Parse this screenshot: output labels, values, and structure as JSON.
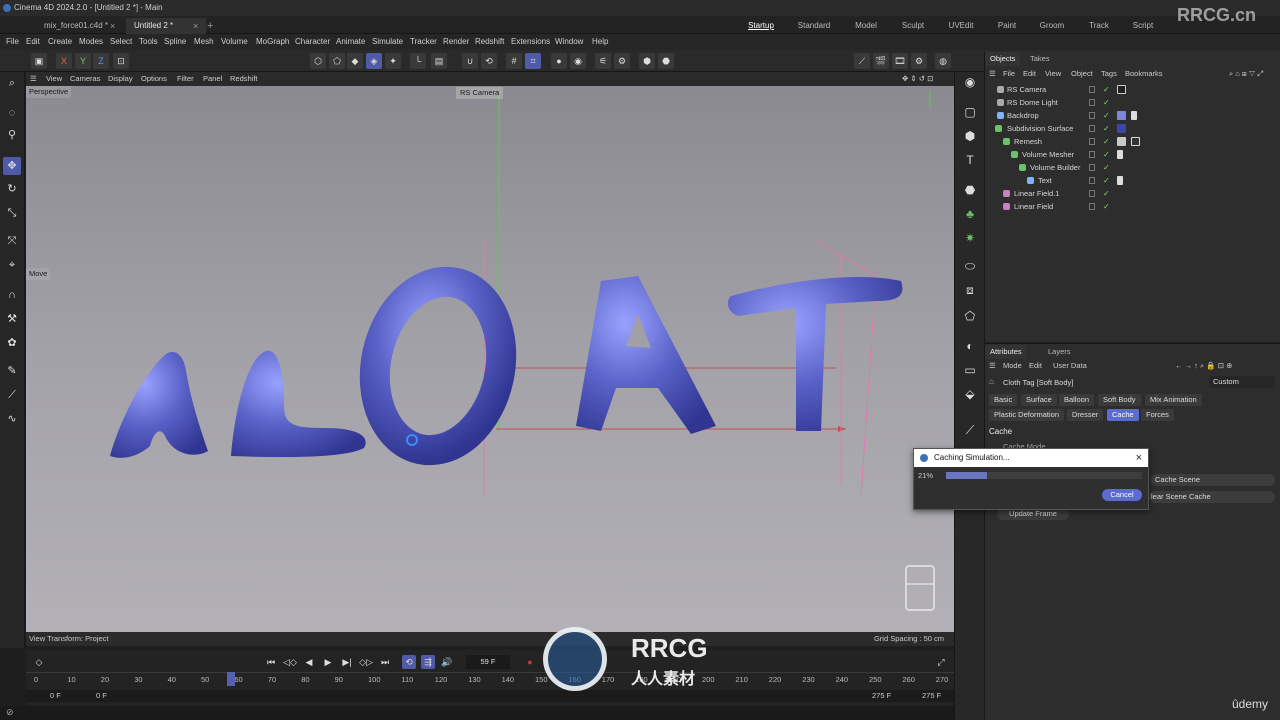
{
  "titlebar": {
    "title": "Cinema 4D 2024.2.0 - [Untitled 2 *] - Main"
  },
  "tabs": {
    "doc1": "mix_force01.c4d *",
    "doc2": "Untitled 2 *",
    "add": "+",
    "close": "×"
  },
  "layouts": [
    "Startup",
    "Standard",
    "Model",
    "Sculpt",
    "UVEdit",
    "Paint",
    "Groom",
    "Track",
    "Script"
  ],
  "menu": [
    "File",
    "Edit",
    "Create",
    "Modes",
    "Select",
    "Tools",
    "Spline",
    "Mesh",
    "Volume",
    "MoGraph",
    "Character",
    "Animate",
    "Simulate",
    "Tracker",
    "Render",
    "Redshift",
    "Extensions",
    "Window",
    "Help"
  ],
  "axes": {
    "x": "X",
    "y": "Y",
    "z": "Z"
  },
  "viewport": {
    "menu": [
      "View",
      "Cameras",
      "Display",
      "Options",
      "Filter",
      "Panel",
      "Redshift"
    ],
    "name": "Perspective",
    "camera": "RS Camera",
    "move_label": "Move",
    "view_transform": "View Transform: Project",
    "grid_spacing": "Grid Spacing : 50 cm",
    "scene_text": "ALOAT"
  },
  "timeline": {
    "current_frame": "59 F",
    "ticks": [
      "0",
      "10",
      "20",
      "30",
      "40",
      "50",
      "60",
      "70",
      "80",
      "90",
      "100",
      "110",
      "120",
      "130",
      "140",
      "150",
      "160",
      "170",
      "180",
      "190",
      "200",
      "210",
      "220",
      "230",
      "240",
      "250",
      "260",
      "270"
    ],
    "range_start": "0 F",
    "range_start2": "0 F",
    "range_end": "275 F",
    "range_end2": "275 F"
  },
  "objects": {
    "tabs": [
      "Objects",
      "Takes"
    ],
    "menu": [
      "File",
      "Edit",
      "View",
      "Object",
      "Tags",
      "Bookmarks"
    ],
    "items": [
      {
        "name": "RS Camera"
      },
      {
        "name": "RS Dome Light"
      },
      {
        "name": "Backdrop"
      },
      {
        "name": "Subdivision Surface"
      },
      {
        "name": "Remesh"
      },
      {
        "name": "Volume Mesher"
      },
      {
        "name": "Volume Builder"
      },
      {
        "name": "Text"
      },
      {
        "name": "Linear Field.1"
      },
      {
        "name": "Linear Field"
      }
    ]
  },
  "attributes": {
    "tabs": [
      "Attributes",
      "Layers"
    ],
    "menu": [
      "Mode",
      "Edit",
      "User Data"
    ],
    "object": "Cloth Tag [Soft Body]",
    "preset": "Custom",
    "subtabs": [
      "Basic",
      "Surface",
      "Balloon",
      "Soft Body",
      "Mix Animation",
      "Plastic Deformation",
      "Dresser",
      "Cache",
      "Forces"
    ],
    "active_subtab": "Cache",
    "section": "Cache",
    "cache_mode_label": "Cache Mode",
    "cache_scene": "Cache Scene",
    "clear_scene_cache": "lear Scene Cache",
    "update_frame": "Update Frame"
  },
  "dialog": {
    "title": "Caching Simulation...",
    "percent_label": "21%",
    "progress": 0.21,
    "cancel": "Cancel",
    "close": "×"
  },
  "watermarks": {
    "top": "RRCG.cn",
    "brand": "RRCG",
    "brand_cn": "人人素材",
    "udemy": "ûdemy"
  },
  "colors": {
    "accent": "#5b6bd1",
    "letters": "#5a62c8",
    "check": "#8ed16b"
  }
}
